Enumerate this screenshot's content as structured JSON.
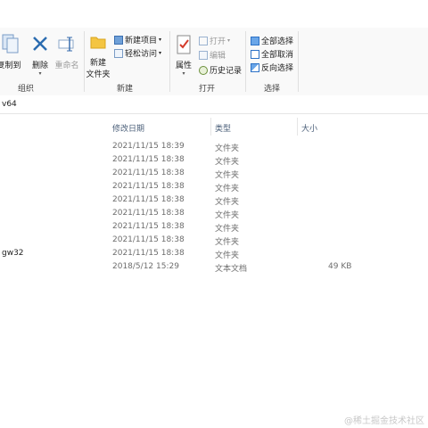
{
  "ribbon": {
    "clipboard": {
      "copy_to_label": "复制到",
      "group_label": "组织"
    },
    "organize": {
      "delete_label": "删除",
      "rename_label": "重命名"
    },
    "new": {
      "new_folder_label": "新建",
      "new_folder_label_2": "文件夹",
      "new_item_label": "新建项目",
      "easy_access_label": "轻松访问",
      "group_label": "新建"
    },
    "open": {
      "properties_label": "属性",
      "open_label": "打开",
      "edit_label": "编辑",
      "history_label": "历史记录",
      "group_label": "打开"
    },
    "select": {
      "select_all_label": "全部选择",
      "select_none_label": "全部取消",
      "invert_label": "反向选择",
      "group_label": "选择"
    }
  },
  "address": {
    "path": "v64"
  },
  "columns": {
    "date": "修改日期",
    "type": "类型",
    "size": "大小"
  },
  "files": [
    {
      "name": "",
      "date": "2021/11/15 18:39",
      "type": "文件夹",
      "size": ""
    },
    {
      "name": "",
      "date": "2021/11/15 18:38",
      "type": "文件夹",
      "size": ""
    },
    {
      "name": "",
      "date": "2021/11/15 18:38",
      "type": "文件夹",
      "size": ""
    },
    {
      "name": "",
      "date": "2021/11/15 18:38",
      "type": "文件夹",
      "size": ""
    },
    {
      "name": "",
      "date": "2021/11/15 18:38",
      "type": "文件夹",
      "size": ""
    },
    {
      "name": "",
      "date": "2021/11/15 18:38",
      "type": "文件夹",
      "size": ""
    },
    {
      "name": "",
      "date": "2021/11/15 18:38",
      "type": "文件夹",
      "size": ""
    },
    {
      "name": "",
      "date": "2021/11/15 18:38",
      "type": "文件夹",
      "size": ""
    },
    {
      "name": "gw32",
      "date": "2021/11/15 18:38",
      "type": "文件夹",
      "size": ""
    },
    {
      "name": "",
      "date": "2018/5/12 15:29",
      "type": "文本文档",
      "size": "49 KB"
    }
  ],
  "watermark": "@稀土掘金技术社区",
  "colors": {
    "accent": "#1e73c8",
    "folder": "#f4c542",
    "delete_x": "#2b6cb0",
    "header_text": "#4c607a"
  }
}
